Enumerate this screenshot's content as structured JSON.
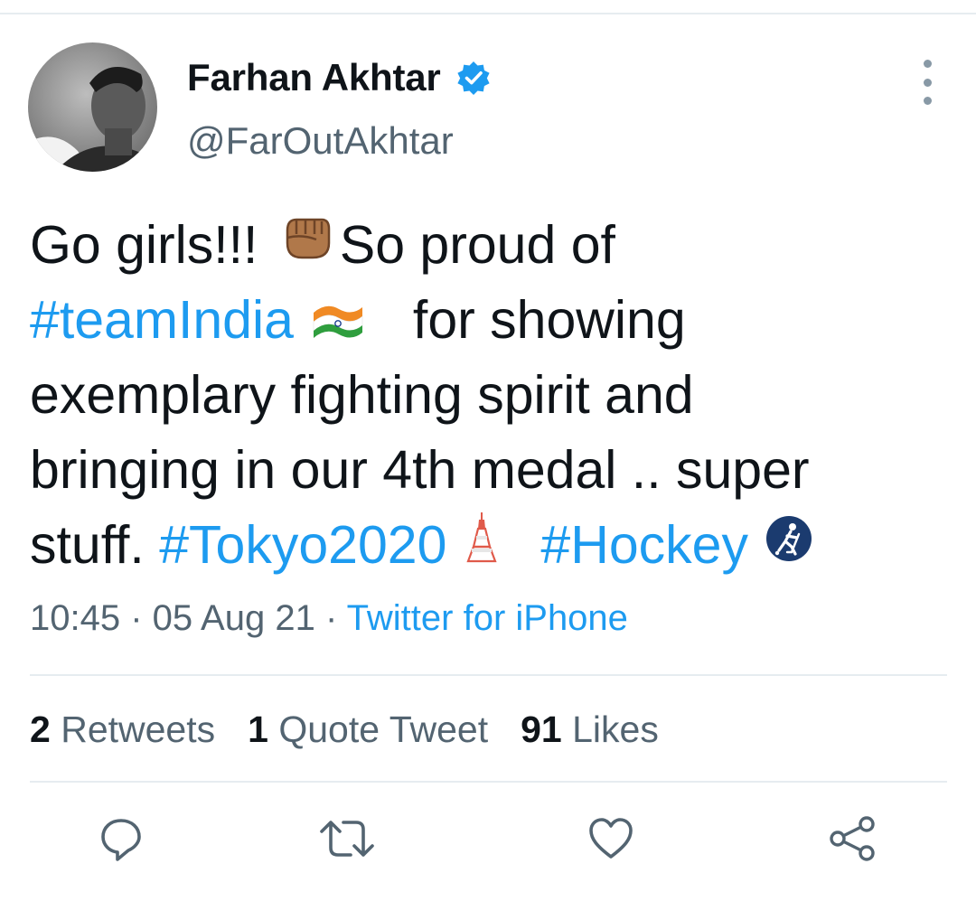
{
  "user": {
    "display_name": "Farhan Akhtar",
    "handle": "@FarOutAkhtar",
    "verified": true
  },
  "tweet": {
    "line1_a": "Go girls!!! ",
    "line1_b": "So proud of",
    "hashtag_team": "#teamIndia",
    "line2_b": "for showing",
    "line3": "exemplary fighting spirit and",
    "line4": "bringing in our 4th medal .. super",
    "line5_a": "stuff. ",
    "hashtag_tokyo": "#Tokyo2020",
    "hashtag_hockey": "#Hockey",
    "emojis": [
      "raised-fist-icon",
      "india-flag-icon",
      "tokyo-tower-icon",
      "field-hockey-icon"
    ]
  },
  "meta": {
    "time": "10:45",
    "sep1": " · ",
    "date": "05 Aug 21",
    "sep2": " · ",
    "source": "Twitter for iPhone"
  },
  "stats": {
    "retweets_count": "2",
    "retweets_label": "Retweets",
    "quotes_count": "1",
    "quotes_label": "Quote Tweet",
    "likes_count": "91",
    "likes_label": "Likes"
  },
  "colors": {
    "link": "#1d9bf0",
    "secondary_text": "#536471",
    "icon": "#536471",
    "divider": "#e6ecf0"
  },
  "actions": [
    "reply-icon",
    "retweet-icon",
    "like-icon",
    "share-icon"
  ]
}
